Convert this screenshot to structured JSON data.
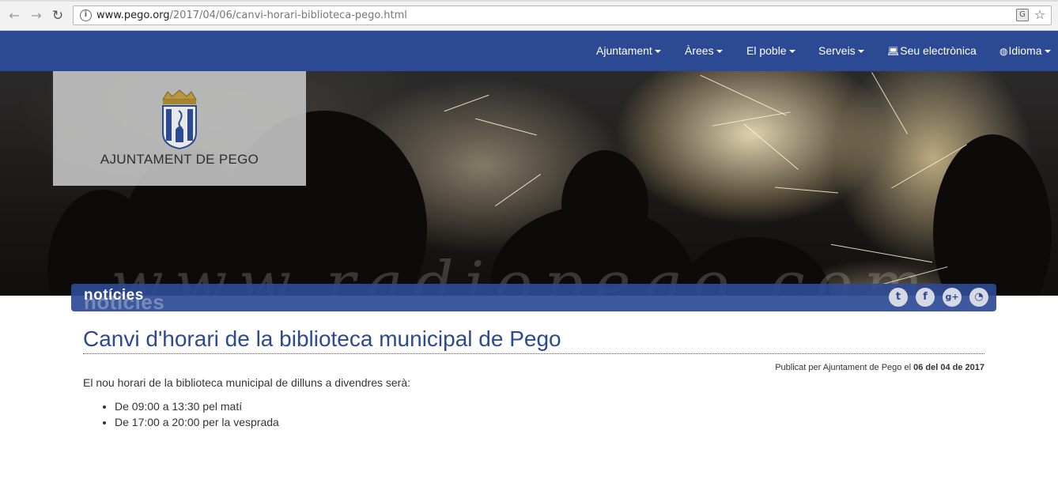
{
  "browser": {
    "url_host": "www.pego.org",
    "url_path": "/2017/04/06/canvi-horari-biblioteca-pego.html"
  },
  "nav": {
    "items": [
      {
        "label": "Ajuntament"
      },
      {
        "label": "Àrees"
      },
      {
        "label": "El poble"
      },
      {
        "label": "Serveis"
      },
      {
        "label": "Seu electrònica"
      },
      {
        "label": "Idioma"
      }
    ]
  },
  "logo": {
    "text": "AJUNTAMENT DE PEGO"
  },
  "hero": {
    "watermark": "www.radiopego.com"
  },
  "section": {
    "title": "notícies"
  },
  "article": {
    "title": "Canvi d'horari de la biblioteca municipal de Pego",
    "published_prefix": "Publicat per Ajuntament de Pego el ",
    "published_date": "06 del 04 de 2017",
    "intro": "El nou horari de la biblioteca municipal de dilluns a divendres serà:",
    "hours": [
      "De 09:00 a 13:30 pel matí",
      "De 17:00 a 20:00 per la vesprada"
    ]
  },
  "colors": {
    "brand": "#2c4a94",
    "background": "#ffffff"
  }
}
